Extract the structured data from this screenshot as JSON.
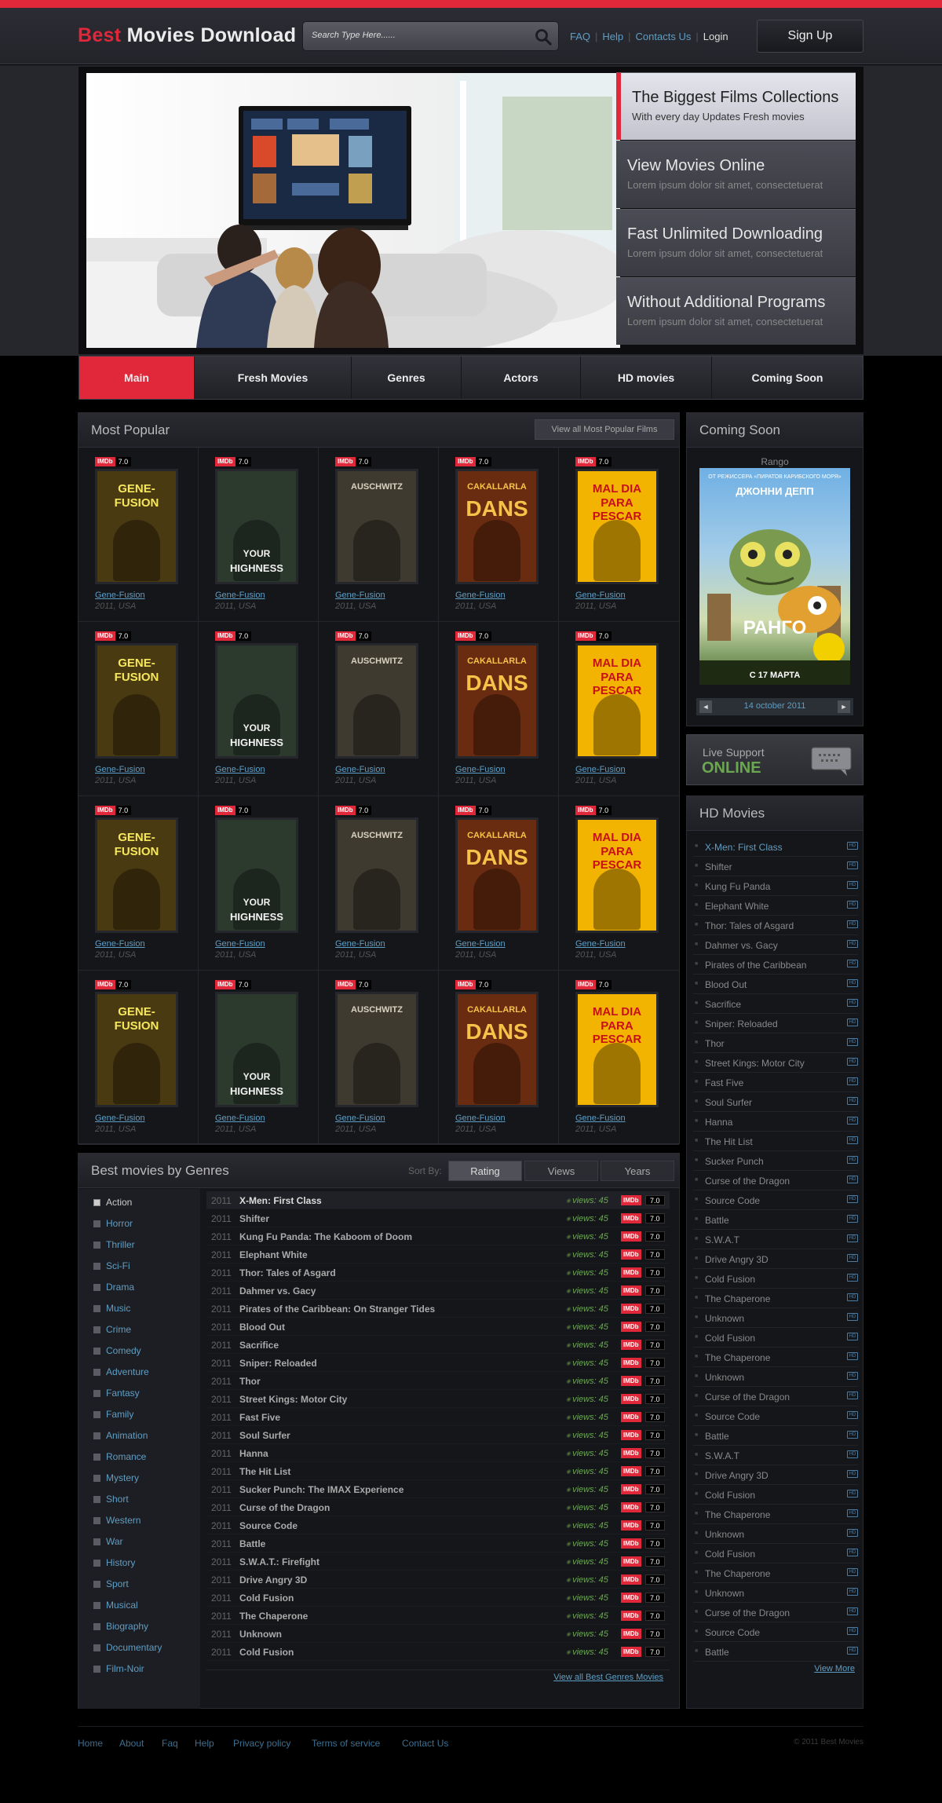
{
  "header": {
    "logo_part1": "Best",
    "logo_part2": "Movies Download",
    "search_placeholder": "Search Type Here......",
    "links": [
      "FAQ",
      "Help",
      "Contacts Us"
    ],
    "login": "Login",
    "signup": "Sign Up"
  },
  "banner": {
    "features": [
      {
        "title": "The Biggest Films Collections",
        "subtitle": "With every day Updates Fresh movies"
      },
      {
        "title": "View Movies Online",
        "subtitle": "Lorem ipsum dolor sit amet, consectetuerat"
      },
      {
        "title": "Fast Unlimited Downloading",
        "subtitle": "Lorem ipsum dolor sit amet, consectetuerat"
      },
      {
        "title": "Without Additional Programs",
        "subtitle": "Lorem ipsum dolor sit amet, consectetuerat"
      }
    ]
  },
  "nav": [
    "Main",
    "Fresh Movies",
    "Genres",
    "Actors",
    "HD movies",
    "Coming Soon"
  ],
  "most_popular": {
    "title": "Most Popular",
    "view_all": "View all Most Popular Films",
    "imdb_label": "IMDb",
    "rating": "7.0",
    "cell_name": "Gene-Fusion",
    "cell_meta": "2011, USA",
    "posters": [
      {
        "line1": "GENE-",
        "line2": "FUSION",
        "bg": "#4a3a12",
        "fg": "#f6e85a"
      },
      {
        "line1": "YOUR",
        "line2": "HIGHNESS",
        "bg": "#2c3a2e",
        "fg": "#f2f2f2"
      },
      {
        "line1": "AUSCHWITZ",
        "line2": "",
        "bg": "#3e3a30",
        "fg": "#d9d2c0"
      },
      {
        "line1": "CAKALLARLA",
        "line2": "DANS",
        "bg": "#6a2c10",
        "fg": "#f7c24a"
      },
      {
        "line1": "MAL DIA",
        "line2": "PARA PESCAR",
        "bg": "#f2b400",
        "fg": "#c8101a"
      }
    ]
  },
  "coming_soon": {
    "title": "Coming Soon",
    "movie": "Rango",
    "poster_top": "ОТ РЕЖИССЕРА «ПИРАТОВ КАРИБСКОГО МОРЯ»",
    "poster_actor": "ДЖОННИ ДЕПП",
    "poster_title": "РАНГО",
    "poster_date": "С 17 МАРТА",
    "date": "14 october 2011",
    "prev": "◄",
    "next": "►"
  },
  "live_support": {
    "line1": "Live Support",
    "line2": "ONLINE"
  },
  "hd_movies": {
    "title": "HD Movies",
    "badge": "HD",
    "items": [
      "X-Men: First Class",
      "Shifter",
      "Kung Fu Panda",
      "Elephant White",
      "Thor: Tales of Asgard",
      "Dahmer vs. Gacy",
      "Pirates of the Caribbean",
      "Blood Out",
      "Sacrifice",
      "Sniper: Reloaded",
      "Thor",
      "Street Kings: Motor City",
      "Fast Five",
      "Soul Surfer",
      "Hanna",
      "The Hit List",
      "Sucker Punch",
      "Curse of the Dragon",
      "Source Code",
      "Battle",
      "S.W.A.T",
      "Drive Angry 3D",
      "Cold Fusion",
      "The Chaperone",
      "Unknown",
      "Cold Fusion",
      "The Chaperone",
      "Unknown",
      "Curse of the Dragon",
      "Source Code",
      "Battle",
      "S.W.A.T",
      "Drive Angry 3D",
      "Cold Fusion",
      "The Chaperone",
      "Unknown",
      "Cold Fusion",
      "The Chaperone",
      "Unknown",
      "Curse of the Dragon",
      "Source Code",
      "Battle"
    ],
    "view_more": "View More"
  },
  "genres": {
    "title": "Best movies by Genres",
    "sort_label": "Sort By:",
    "sort_options": [
      "Rating",
      "Views",
      "Years"
    ],
    "list": [
      "Action",
      "Horror",
      "Thriller",
      "Sci-Fi",
      "Drama",
      "Music",
      "Crime",
      "Comedy",
      "Adventure",
      "Fantasy",
      "Family",
      "Animation",
      "Romance",
      "Mystery",
      "Short",
      "Western",
      "War",
      "History",
      "Sport",
      "Musical",
      "Biography",
      "Documentary",
      "Film-Noir"
    ],
    "year": "2011",
    "views": "views: 45",
    "imdb_label": "IMDb",
    "rating": "7.0",
    "movies": [
      "X-Men: First Class",
      "Shifter",
      "Kung Fu Panda: The Kaboom of Doom",
      "Elephant White",
      "Thor: Tales of Asgard",
      "Dahmer vs. Gacy",
      "Pirates of the Caribbean: On Stranger Tides",
      "Blood Out",
      "Sacrifice",
      "Sniper: Reloaded",
      "Thor",
      "Street Kings: Motor City",
      "Fast Five",
      "Soul Surfer",
      "Hanna",
      "The Hit List",
      "Sucker Punch: The IMAX Experience",
      "Curse of the Dragon",
      "Source Code",
      "Battle",
      "S.W.A.T.: Firefight",
      "Drive Angry 3D",
      "Cold Fusion",
      "The Chaperone",
      "Unknown",
      "Cold Fusion"
    ],
    "view_all": "View all Best Genres Movies"
  },
  "footer": {
    "links": [
      "Home",
      "About",
      "Faq",
      "Help",
      "Privacy policy",
      "Terms of service",
      "Contact Us"
    ],
    "copyright": "© 2011 Best Movies"
  },
  "colors": {
    "accent": "#e0283a",
    "link": "#5f9ec4",
    "online": "#6aa84f"
  }
}
